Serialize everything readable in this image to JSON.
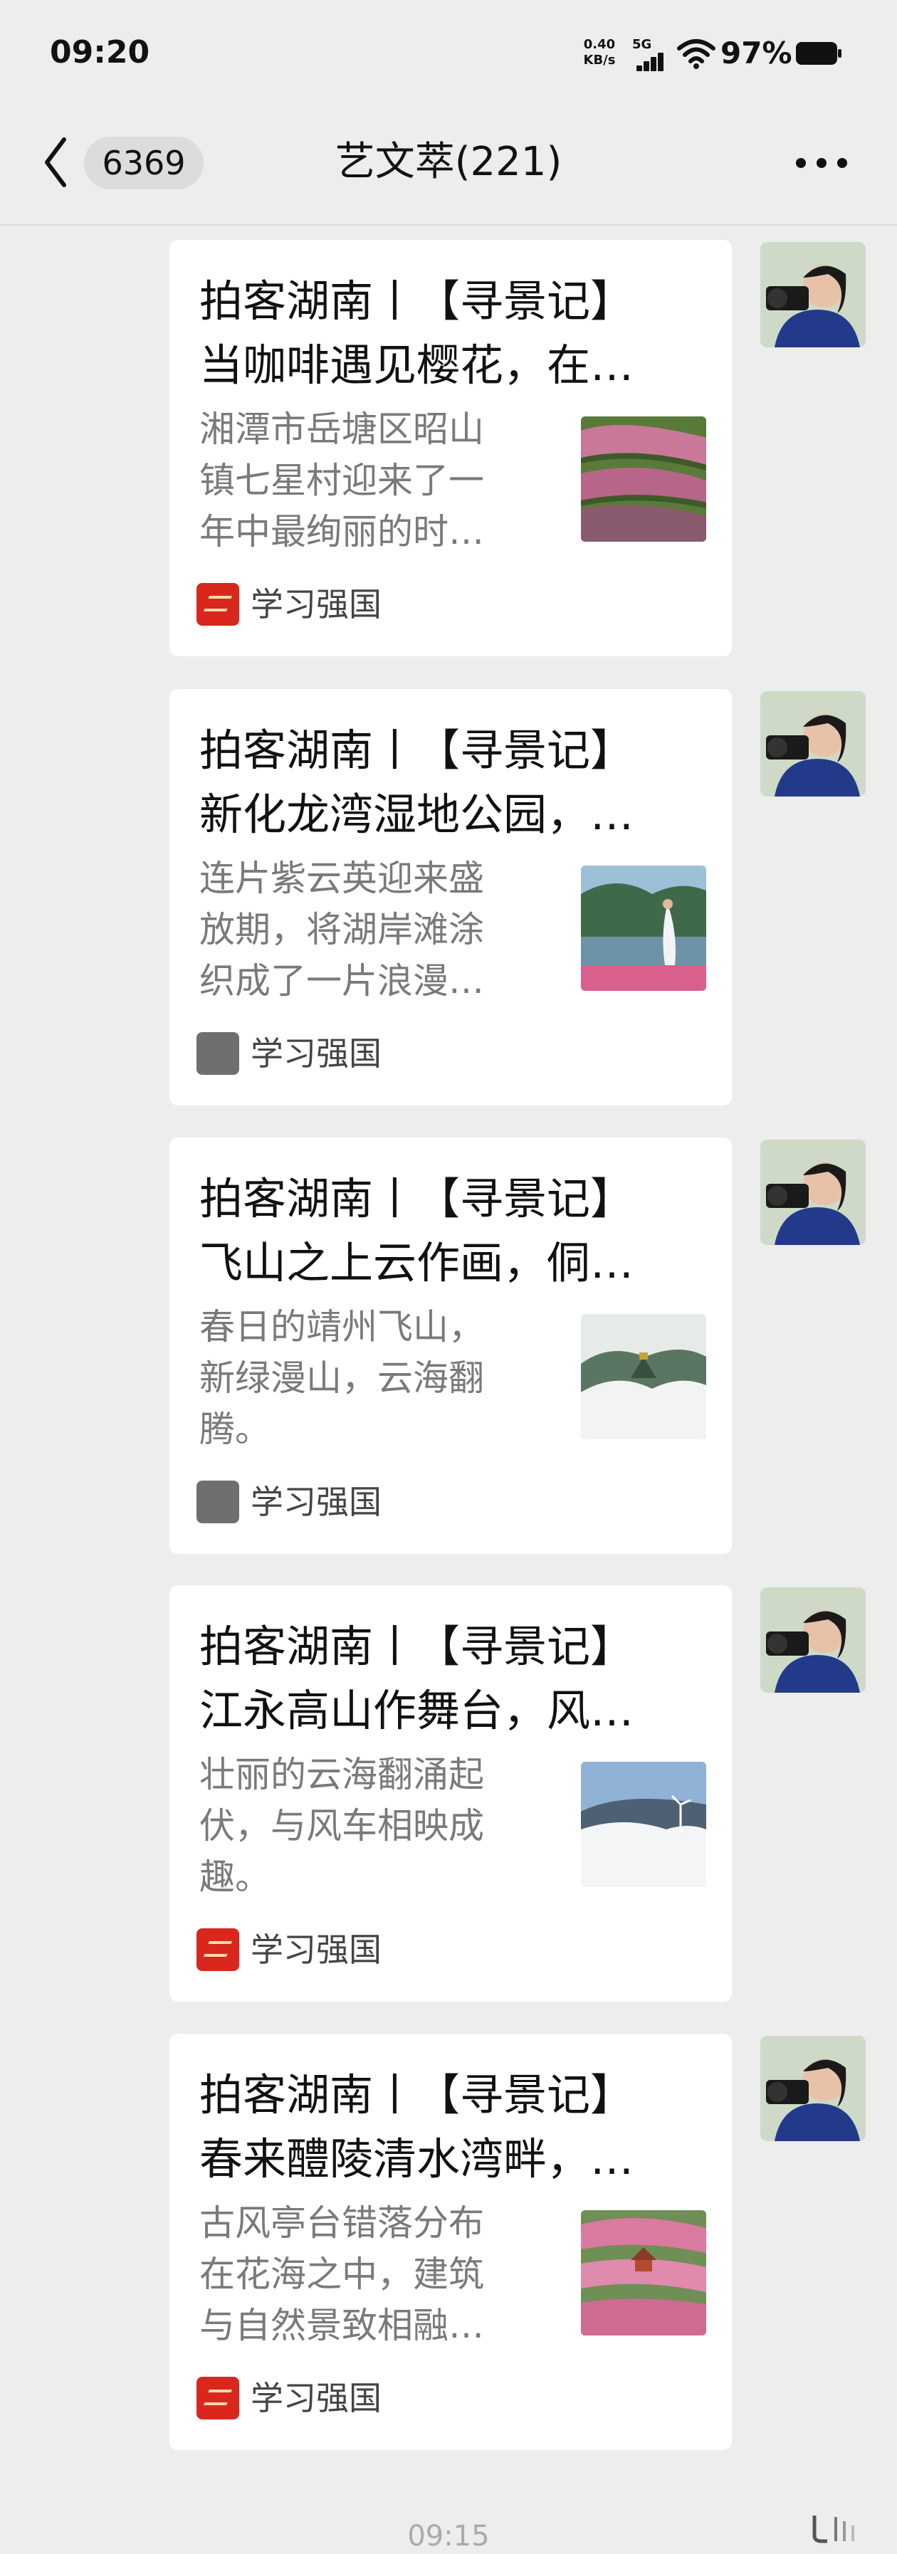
{
  "status_bar": {
    "time": "09:20",
    "net_speed_value": "0.40",
    "net_speed_unit": "KB/s",
    "network_type": "5G",
    "battery_percent": "97%"
  },
  "nav": {
    "back_badge": "6369",
    "title": "艺文萃(221)"
  },
  "messages": [
    {
      "title_line1": "拍客湖南丨【寻景记】",
      "title_line2": "当咖啡遇见樱花，在…",
      "desc_line1": "湘潭市岳塘区昭山",
      "desc_line2": "镇七星村迎来了一",
      "desc_line3": "年中最绚丽的时…",
      "source": "学习强国",
      "source_logo": "xuexi-qiangguo-logo"
    },
    {
      "title_line1": "拍客湖南丨【寻景记】",
      "title_line2": "新化龙湾湿地公园，…",
      "desc_line1": "连片紫云英迎来盛",
      "desc_line2": "放期，将湖岸滩涂",
      "desc_line3": "织成了一片浪漫…",
      "source": "学习强国",
      "source_logo": "gray-placeholder-logo"
    },
    {
      "title_line1": "拍客湖南丨【寻景记】",
      "title_line2": "飞山之上云作画，侗…",
      "desc_line1": "春日的靖州飞山，",
      "desc_line2": "新绿漫山，云海翻",
      "desc_line3": "腾。",
      "source": "学习强国",
      "source_logo": "gray-placeholder-logo"
    },
    {
      "title_line1": "拍客湖南丨【寻景记】",
      "title_line2": "江永高山作舞台，风…",
      "desc_line1": "壮丽的云海翻涌起",
      "desc_line2": "伏，与风车相映成",
      "desc_line3": "趣。",
      "source": "学习强国",
      "source_logo": "xuexi-qiangguo-logo"
    },
    {
      "title_line1": "拍客湖南丨【寻景记】",
      "title_line2": "春来醴陵清水湾畔，…",
      "desc_line1": "古风亭台错落分布",
      "desc_line2": "在花海之中，建筑",
      "desc_line3": "与自然景致相融…",
      "source": "学习强国",
      "source_logo": "xuexi-qiangguo-logo"
    }
  ],
  "footer": {
    "time": "09:15"
  },
  "colors": {
    "background": "#ededed",
    "card": "#ffffff",
    "source_red": "#d9271d"
  }
}
